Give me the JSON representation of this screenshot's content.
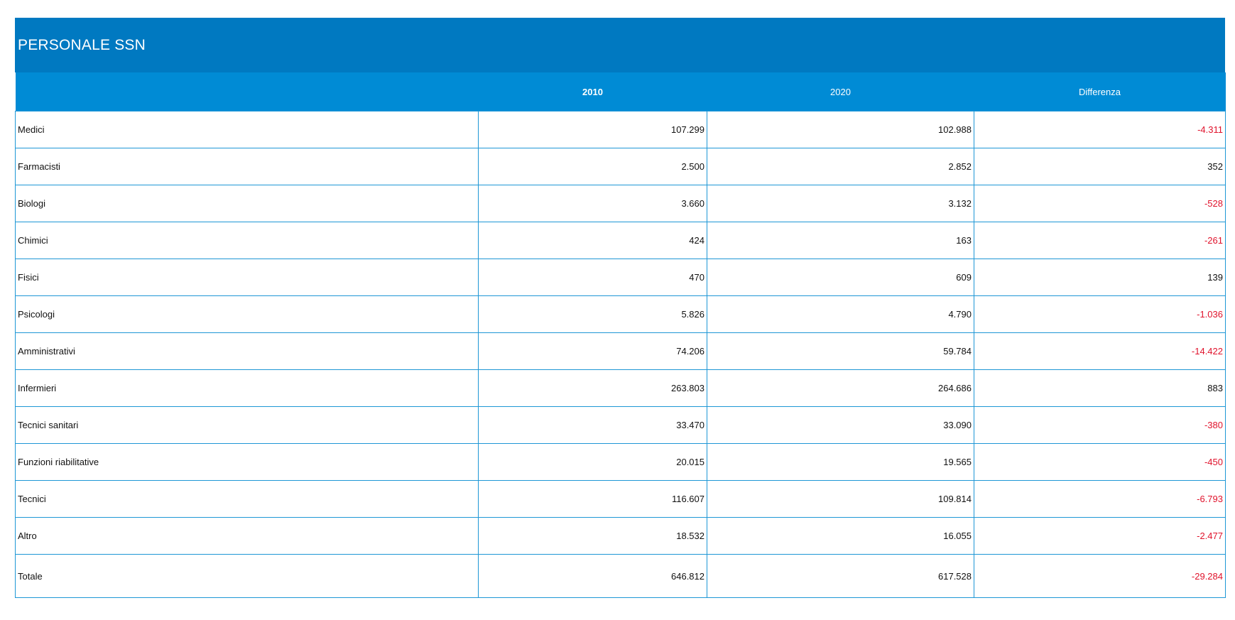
{
  "title": "PERSONALE SSN",
  "columns": [
    "",
    "2010",
    "2020",
    "Differenza"
  ],
  "rows": [
    {
      "label": "Medici",
      "y2010": "107.299",
      "y2020": "102.988",
      "diff": "-4.311"
    },
    {
      "label": "Farmacisti",
      "y2010": "2.500",
      "y2020": "2.852",
      "diff": "352"
    },
    {
      "label": "Biologi",
      "y2010": "3.660",
      "y2020": "3.132",
      "diff": "-528"
    },
    {
      "label": "Chimici",
      "y2010": "424",
      "y2020": "163",
      "diff": "-261"
    },
    {
      "label": "Fisici",
      "y2010": "470",
      "y2020": "609",
      "diff": "139"
    },
    {
      "label": "Psicologi",
      "y2010": "5.826",
      "y2020": "4.790",
      "diff": "-1.036"
    },
    {
      "label": "Amministrativi",
      "y2010": "74.206",
      "y2020": "59.784",
      "diff": "-14.422"
    },
    {
      "label": "Infermieri",
      "y2010": "263.803",
      "y2020": "264.686",
      "diff": "883"
    },
    {
      "label": "Tecnici sanitari",
      "y2010": "33.470",
      "y2020": "33.090",
      "diff": "-380"
    },
    {
      "label": "Funzioni riabilitative",
      "y2010": "20.015",
      "y2020": "19.565",
      "diff": "-450"
    },
    {
      "label": "Tecnici",
      "y2010": "116.607",
      "y2020": "109.814",
      "diff": "-6.793"
    },
    {
      "label": "Altro",
      "y2010": "18.532",
      "y2020": "16.055",
      "diff": "-2.477"
    },
    {
      "label": "Totale",
      "y2010": "646.812",
      "y2020": "617.528",
      "diff": "-29.284"
    }
  ],
  "colors": {
    "title_bg": "#0079c1",
    "header_bg": "#008bd5",
    "border": "#1e97d6",
    "negative": "#e0122b"
  }
}
